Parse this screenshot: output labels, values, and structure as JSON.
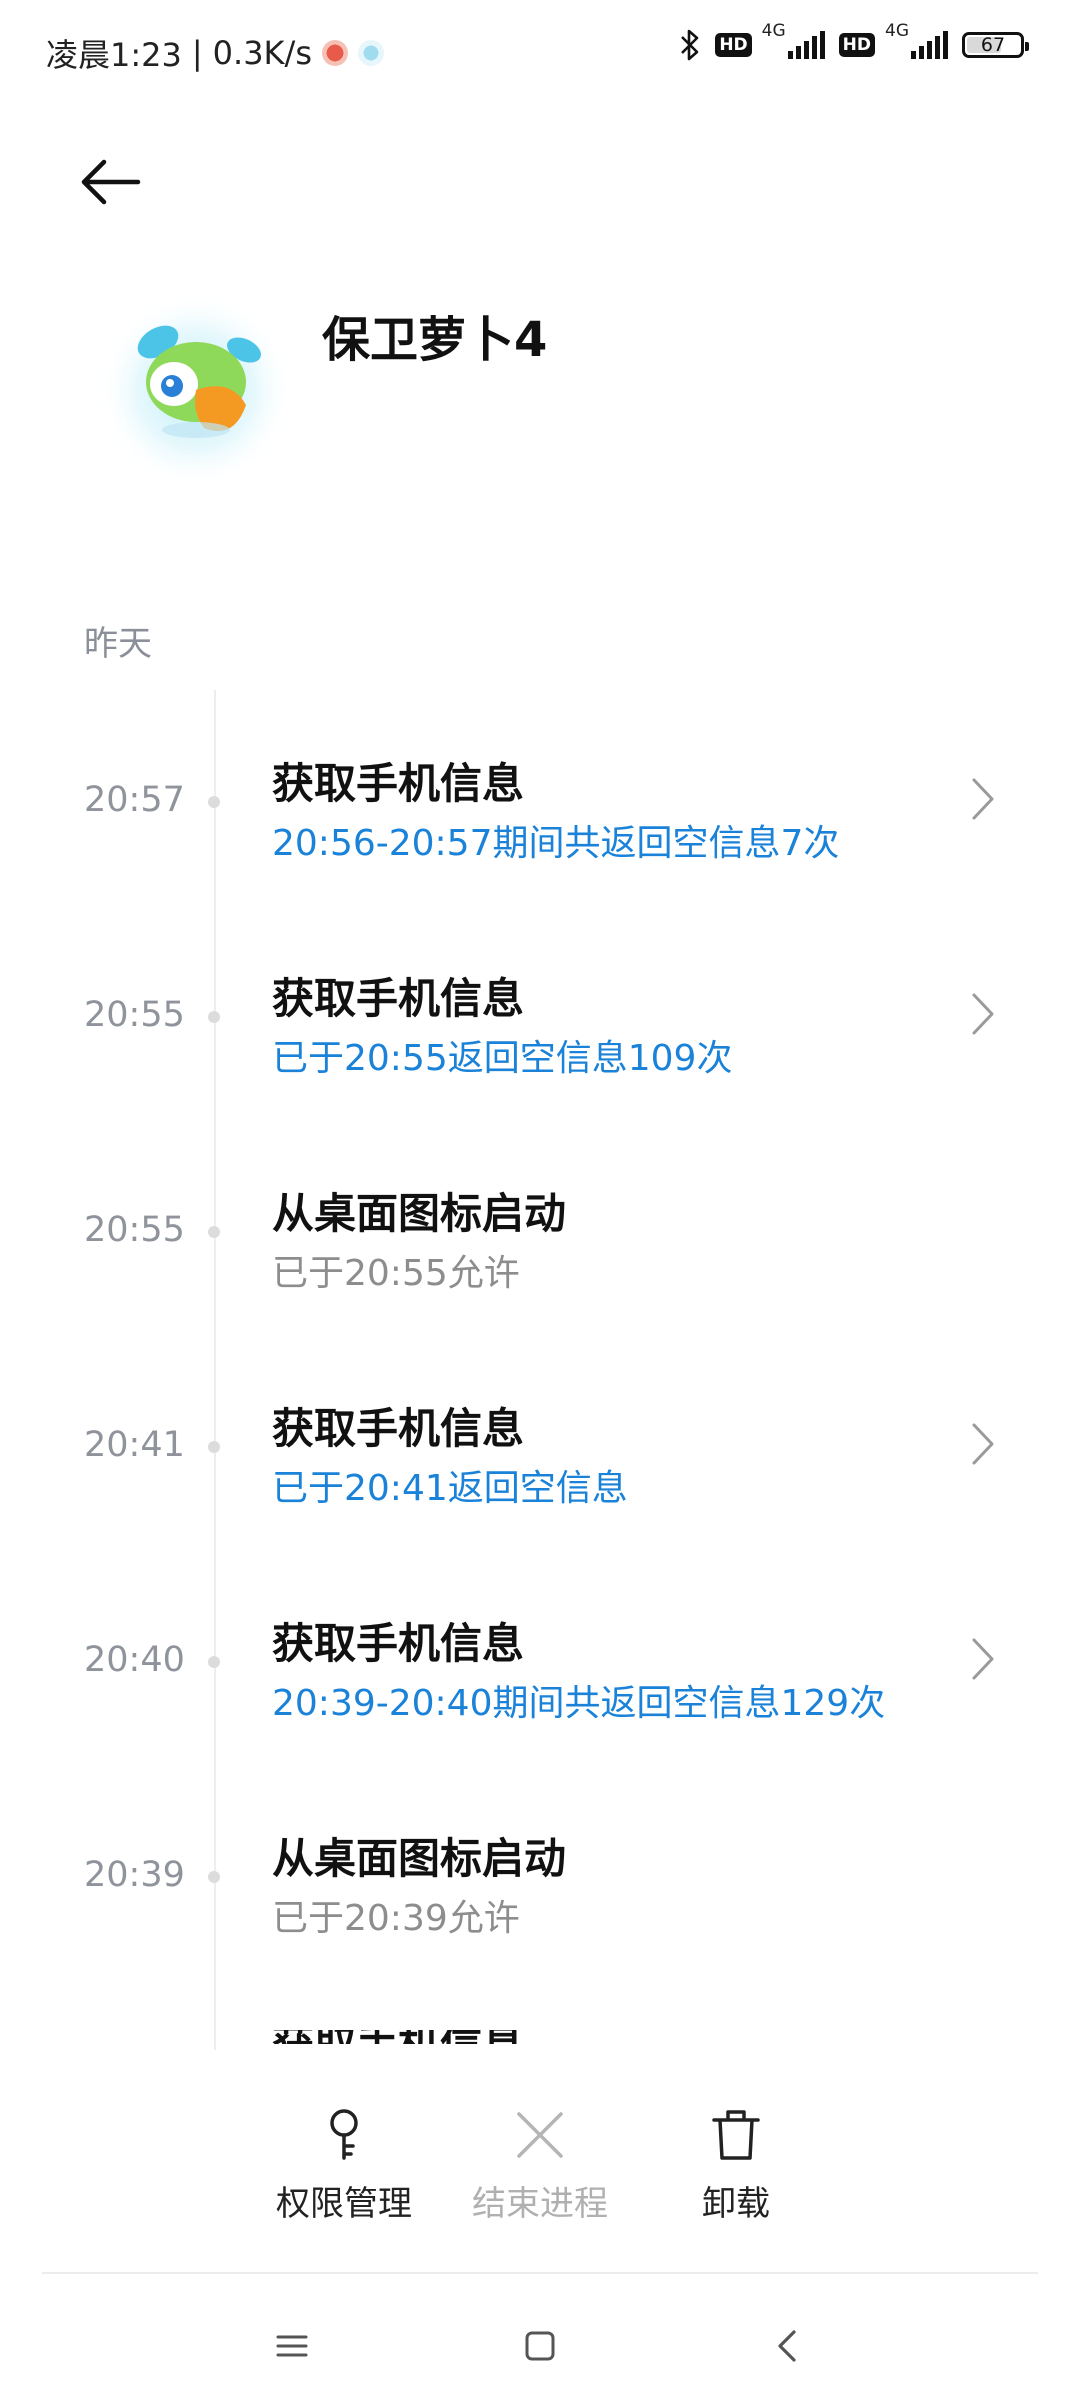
{
  "status_bar": {
    "time": "凌晨1:23",
    "net_speed": "0.3K/s",
    "separator": "|",
    "hd1": "HD",
    "hd2": "HD",
    "net1": "4G",
    "net2": "4G",
    "battery": "67",
    "battery_level": 0.67,
    "icons": [
      "notification-app-icon",
      "notification-app-icon-2",
      "bluetooth-icon",
      "signal-icon",
      "signal-icon",
      "battery-icon"
    ]
  },
  "header": {
    "back_icon": "back-arrow-icon"
  },
  "app": {
    "name": "保卫萝卜4",
    "icon": "app-icon"
  },
  "day_label": "昨天",
  "records": [
    {
      "time": "20:57",
      "title": "获取手机信息",
      "sub": "20:56-20:57期间共返回空信息7次",
      "sub_color": "#1a82d8",
      "chevron": true
    },
    {
      "time": "20:55",
      "title": "获取手机信息",
      "sub": "已于20:55返回空信息109次",
      "sub_color": "#1a82d8",
      "chevron": true
    },
    {
      "time": "20:55",
      "title": "从桌面图标启动",
      "sub": "已于20:55允许",
      "sub_color": "#8d8d8d",
      "chevron": false
    },
    {
      "time": "20:41",
      "title": "获取手机信息",
      "sub": "已于20:41返回空信息",
      "sub_color": "#1a82d8",
      "chevron": true
    },
    {
      "time": "20:40",
      "title": "获取手机信息",
      "sub": "20:39-20:40期间共返回空信息129次",
      "sub_color": "#1a82d8",
      "chevron": true
    },
    {
      "time": "20:39",
      "title": "从桌面图标启动",
      "sub": "已于20:39允许",
      "sub_color": "#8d8d8d",
      "chevron": false
    }
  ],
  "partial_row_title": "获取手机信息",
  "actions": [
    {
      "label": "权限管理",
      "icon": "key-icon",
      "enabled": true
    },
    {
      "label": "结束进程",
      "icon": "close-icon",
      "enabled": false
    },
    {
      "label": "卸载",
      "icon": "trash-icon",
      "enabled": true
    }
  ],
  "nav_bar": {
    "icons": [
      "menu-icon",
      "home-icon",
      "back-icon"
    ]
  },
  "colors": {
    "accent": "#1a82d8",
    "muted": "#8f939b"
  }
}
